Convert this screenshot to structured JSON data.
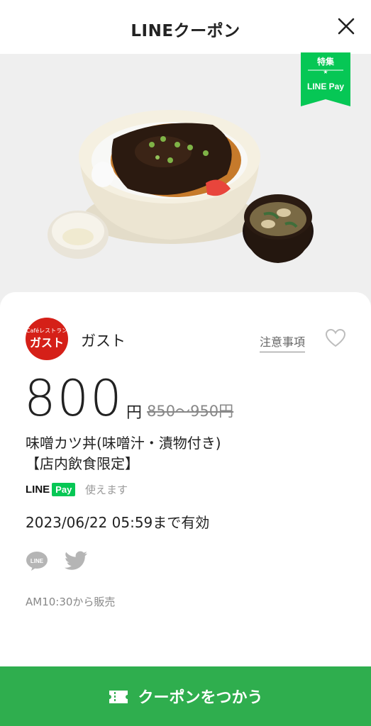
{
  "header": {
    "title": "LINEクーポン",
    "close_icon": "close-icon"
  },
  "badge": {
    "top_text": "特集",
    "bottom_text": "LINE Pay"
  },
  "shop": {
    "logo_top": "Caféレストラン",
    "logo_main": "ガスト",
    "name": "ガスト"
  },
  "notice_label": "注意事項",
  "price": {
    "value": "800",
    "unit": "円",
    "original": "850〜950円"
  },
  "description": {
    "line1": "味噌カツ丼(味噌汁・漬物付き)",
    "line2": "【店内飲食限定】"
  },
  "line_pay": {
    "line": "LINE",
    "pay": "Pay",
    "text": "使えます"
  },
  "validity": "2023/06/22  05:59まで有効",
  "share": {
    "line_label": "LINE"
  },
  "sale_time": "AM10:30から販売",
  "cta_label": "クーポンをつかう",
  "colors": {
    "green": "#2fae4e",
    "badge_green": "#06c755",
    "logo_red": "#d52018"
  }
}
